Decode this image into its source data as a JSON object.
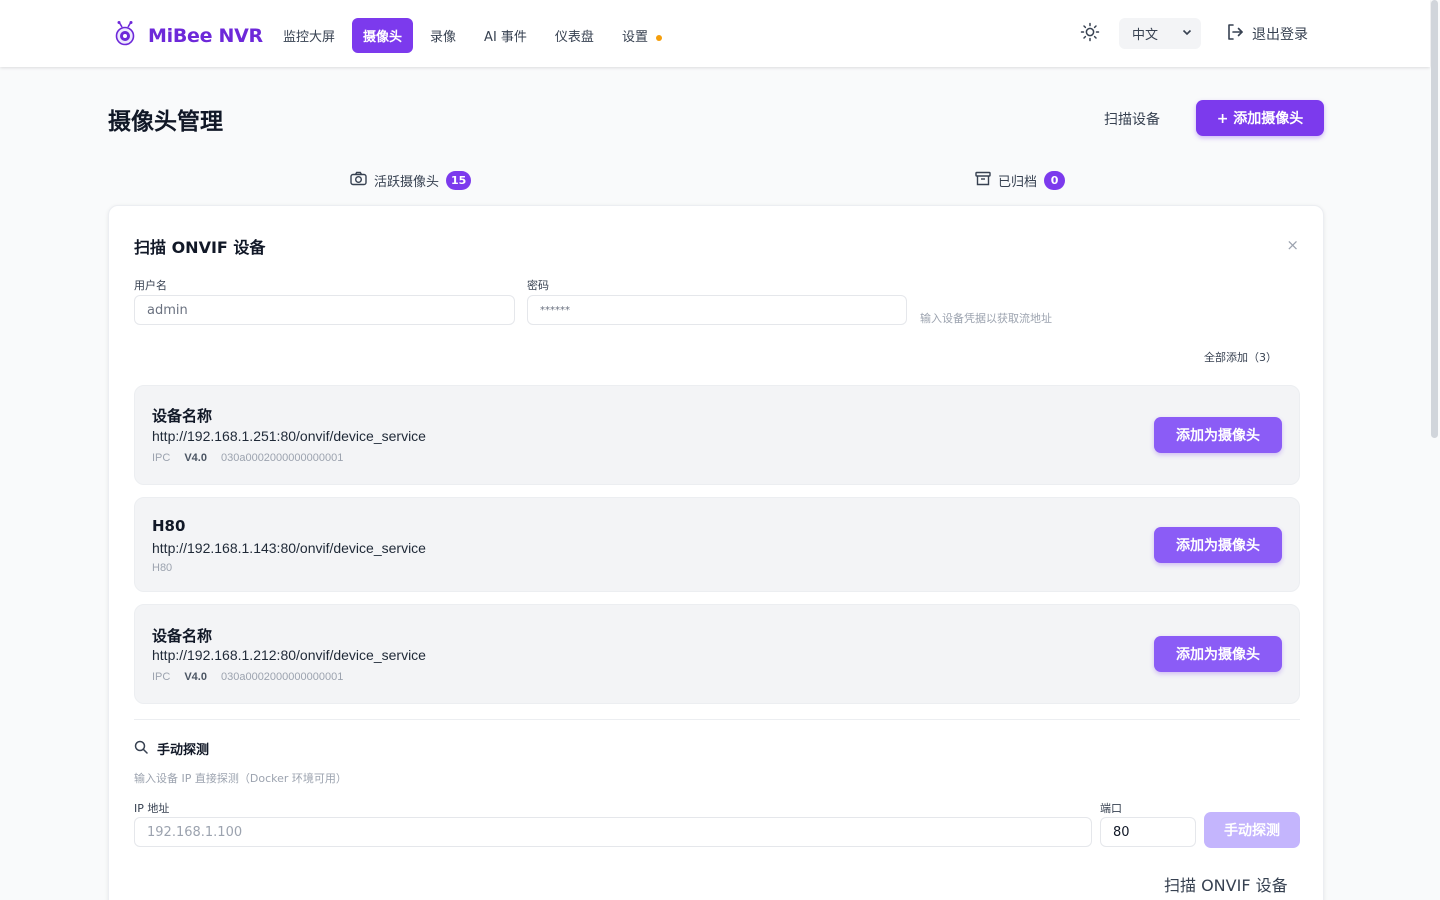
{
  "nav": {
    "logo_text": "MiBee NVR",
    "items": [
      {
        "label": "监控大屏",
        "active": false
      },
      {
        "label": "摄像头",
        "active": true
      },
      {
        "label": "录像",
        "active": false
      },
      {
        "label": "AI 事件",
        "active": false
      },
      {
        "label": "仪表盘",
        "active": false
      },
      {
        "label": "设置",
        "active": false,
        "dot": true
      }
    ],
    "language": "中文",
    "logout_label": "退出登录"
  },
  "header": {
    "title": "摄像头管理",
    "scan_label": "扫描设备",
    "add_label": "+ 添加摄像头"
  },
  "tabs": [
    {
      "label": "活跃摄像头",
      "count": "15",
      "icon": "camera-icon"
    },
    {
      "label": "已归档",
      "count": "0",
      "icon": "archive-icon"
    }
  ],
  "scan_panel": {
    "title": "扫描 ONVIF 设备",
    "close_label": "×",
    "username_label": "用户名",
    "username_value": "admin",
    "password_label": "密码",
    "password_value": "******",
    "hint": "输入设备凭据以获取流地址",
    "add_all_label": "全部添加（3）",
    "devices": [
      {
        "name": "设备名称",
        "url": "http://192.168.1.251:80/onvif/device_service",
        "type": "IPC",
        "version": "V4.0",
        "serial": "030a0002000000000001",
        "button": "添加为摄像头"
      },
      {
        "name": "H80",
        "url": "http://192.168.1.143:80/onvif/device_service",
        "type": "H80",
        "version": "",
        "serial": "",
        "button": "添加为摄像头"
      },
      {
        "name": "设备名称",
        "url": "http://192.168.1.212:80/onvif/device_service",
        "type": "IPC",
        "version": "V4.0",
        "serial": "030a0002000000000001",
        "button": "添加为摄像头"
      }
    ],
    "manual": {
      "title": "手动探测",
      "hint": "输入设备 IP 直接探测（Docker 环境可用）",
      "ip_label": "IP 地址",
      "ip_placeholder": "192.168.1.100",
      "port_label": "端口",
      "port_value": "80",
      "probe_label": "手动探测"
    },
    "footer_link": "扫描 ONVIF 设备"
  },
  "colors": {
    "accent": "#7c3aed",
    "accent_light": "#8b5cf6",
    "disabled": "#c4b5fd",
    "warning_dot": "#f59e0b"
  }
}
